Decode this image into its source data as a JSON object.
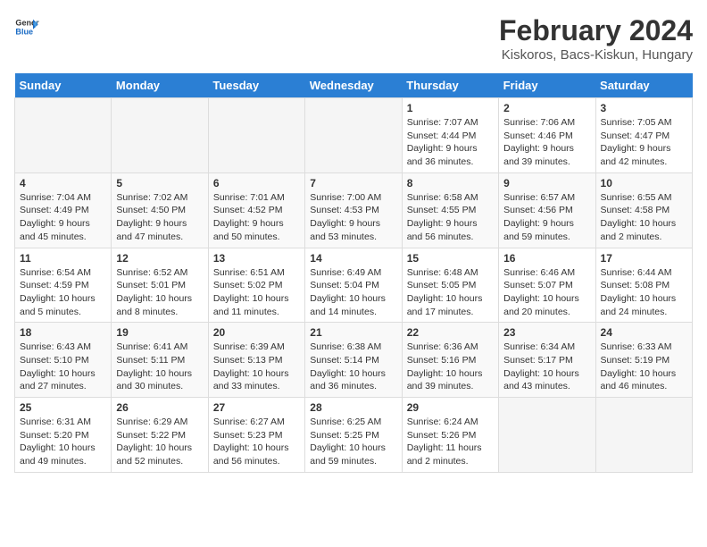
{
  "header": {
    "logo_line1": "General",
    "logo_line2": "Blue",
    "title": "February 2024",
    "subtitle": "Kiskoros, Bacs-Kiskun, Hungary"
  },
  "weekdays": [
    "Sunday",
    "Monday",
    "Tuesday",
    "Wednesday",
    "Thursday",
    "Friday",
    "Saturday"
  ],
  "weeks": [
    [
      {
        "day": "",
        "info": ""
      },
      {
        "day": "",
        "info": ""
      },
      {
        "day": "",
        "info": ""
      },
      {
        "day": "",
        "info": ""
      },
      {
        "day": "1",
        "info": "Sunrise: 7:07 AM\nSunset: 4:44 PM\nDaylight: 9 hours and 36 minutes."
      },
      {
        "day": "2",
        "info": "Sunrise: 7:06 AM\nSunset: 4:46 PM\nDaylight: 9 hours and 39 minutes."
      },
      {
        "day": "3",
        "info": "Sunrise: 7:05 AM\nSunset: 4:47 PM\nDaylight: 9 hours and 42 minutes."
      }
    ],
    [
      {
        "day": "4",
        "info": "Sunrise: 7:04 AM\nSunset: 4:49 PM\nDaylight: 9 hours and 45 minutes."
      },
      {
        "day": "5",
        "info": "Sunrise: 7:02 AM\nSunset: 4:50 PM\nDaylight: 9 hours and 47 minutes."
      },
      {
        "day": "6",
        "info": "Sunrise: 7:01 AM\nSunset: 4:52 PM\nDaylight: 9 hours and 50 minutes."
      },
      {
        "day": "7",
        "info": "Sunrise: 7:00 AM\nSunset: 4:53 PM\nDaylight: 9 hours and 53 minutes."
      },
      {
        "day": "8",
        "info": "Sunrise: 6:58 AM\nSunset: 4:55 PM\nDaylight: 9 hours and 56 minutes."
      },
      {
        "day": "9",
        "info": "Sunrise: 6:57 AM\nSunset: 4:56 PM\nDaylight: 9 hours and 59 minutes."
      },
      {
        "day": "10",
        "info": "Sunrise: 6:55 AM\nSunset: 4:58 PM\nDaylight: 10 hours and 2 minutes."
      }
    ],
    [
      {
        "day": "11",
        "info": "Sunrise: 6:54 AM\nSunset: 4:59 PM\nDaylight: 10 hours and 5 minutes."
      },
      {
        "day": "12",
        "info": "Sunrise: 6:52 AM\nSunset: 5:01 PM\nDaylight: 10 hours and 8 minutes."
      },
      {
        "day": "13",
        "info": "Sunrise: 6:51 AM\nSunset: 5:02 PM\nDaylight: 10 hours and 11 minutes."
      },
      {
        "day": "14",
        "info": "Sunrise: 6:49 AM\nSunset: 5:04 PM\nDaylight: 10 hours and 14 minutes."
      },
      {
        "day": "15",
        "info": "Sunrise: 6:48 AM\nSunset: 5:05 PM\nDaylight: 10 hours and 17 minutes."
      },
      {
        "day": "16",
        "info": "Sunrise: 6:46 AM\nSunset: 5:07 PM\nDaylight: 10 hours and 20 minutes."
      },
      {
        "day": "17",
        "info": "Sunrise: 6:44 AM\nSunset: 5:08 PM\nDaylight: 10 hours and 24 minutes."
      }
    ],
    [
      {
        "day": "18",
        "info": "Sunrise: 6:43 AM\nSunset: 5:10 PM\nDaylight: 10 hours and 27 minutes."
      },
      {
        "day": "19",
        "info": "Sunrise: 6:41 AM\nSunset: 5:11 PM\nDaylight: 10 hours and 30 minutes."
      },
      {
        "day": "20",
        "info": "Sunrise: 6:39 AM\nSunset: 5:13 PM\nDaylight: 10 hours and 33 minutes."
      },
      {
        "day": "21",
        "info": "Sunrise: 6:38 AM\nSunset: 5:14 PM\nDaylight: 10 hours and 36 minutes."
      },
      {
        "day": "22",
        "info": "Sunrise: 6:36 AM\nSunset: 5:16 PM\nDaylight: 10 hours and 39 minutes."
      },
      {
        "day": "23",
        "info": "Sunrise: 6:34 AM\nSunset: 5:17 PM\nDaylight: 10 hours and 43 minutes."
      },
      {
        "day": "24",
        "info": "Sunrise: 6:33 AM\nSunset: 5:19 PM\nDaylight: 10 hours and 46 minutes."
      }
    ],
    [
      {
        "day": "25",
        "info": "Sunrise: 6:31 AM\nSunset: 5:20 PM\nDaylight: 10 hours and 49 minutes."
      },
      {
        "day": "26",
        "info": "Sunrise: 6:29 AM\nSunset: 5:22 PM\nDaylight: 10 hours and 52 minutes."
      },
      {
        "day": "27",
        "info": "Sunrise: 6:27 AM\nSunset: 5:23 PM\nDaylight: 10 hours and 56 minutes."
      },
      {
        "day": "28",
        "info": "Sunrise: 6:25 AM\nSunset: 5:25 PM\nDaylight: 10 hours and 59 minutes."
      },
      {
        "day": "29",
        "info": "Sunrise: 6:24 AM\nSunset: 5:26 PM\nDaylight: 11 hours and 2 minutes."
      },
      {
        "day": "",
        "info": ""
      },
      {
        "day": "",
        "info": ""
      }
    ]
  ]
}
